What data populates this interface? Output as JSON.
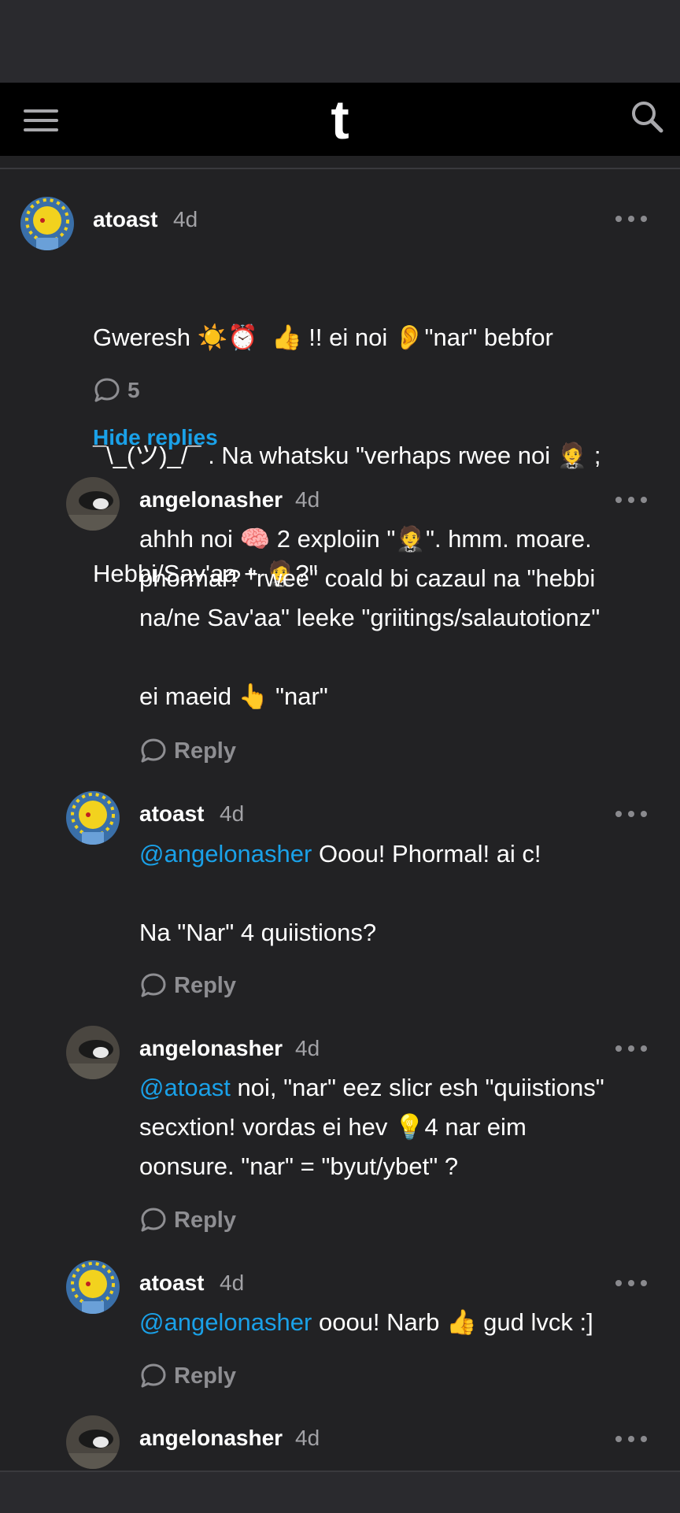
{
  "header": {
    "menu_icon": "hamburger-menu-icon",
    "logo_letter": "t",
    "search_icon": "search-icon"
  },
  "colors": {
    "background": "#222224",
    "accent": "#1aa1e8",
    "muted": "#8e8e92"
  },
  "post_comment": {
    "author": "atoast",
    "time": "4d",
    "text_lines": [
      "Gweresh ☀️⏰  👍 !! ei noi 👂\"nar\" bebfor",
      "¯\\_(ツ)_/¯ . Na whatsku \"verhaps rwee noi 🤵 ;",
      "Hebbi/Sav'aa + 🤵?\""
    ],
    "reply_count": "5",
    "hide_replies": "Hide replies"
  },
  "replies": [
    {
      "author": "angelonasher",
      "time": "4d",
      "mention": "",
      "text": "ahhh noi 🧠 2 exploiin \"🤵\". hmm. moare.\nphormal? \"rwee\" coald bi cazaul na \"hebbi\nna/ne Sav'aa\" leeke \"griitings/salautotionz\"\n\nei maeid 👆 \"nar\"",
      "reply_label": "Reply"
    },
    {
      "author": "atoast",
      "time": "4d",
      "mention": "@angelonasher",
      "text": " Ooou! Phormal! ai c!\n\nNa \"Nar\" 4 quiistions?",
      "reply_label": "Reply"
    },
    {
      "author": "angelonasher",
      "time": "4d",
      "mention": "@atoast",
      "text": " noi, \"nar\" eez slicr esh \"quiistions\"\nsecxtion! vordas ei hev 💡4 nar eim\noonsure. \"nar\" = \"byut/ybet\" ?",
      "reply_label": "Reply"
    },
    {
      "author": "atoast",
      "time": "4d",
      "mention": "@angelonasher",
      "text": " ooou! Narb 👍 gud lvck :]",
      "reply_label": "Reply"
    },
    {
      "author": "angelonasher",
      "time": "4d",
      "mention": "",
      "text": "",
      "reply_label": ""
    }
  ]
}
